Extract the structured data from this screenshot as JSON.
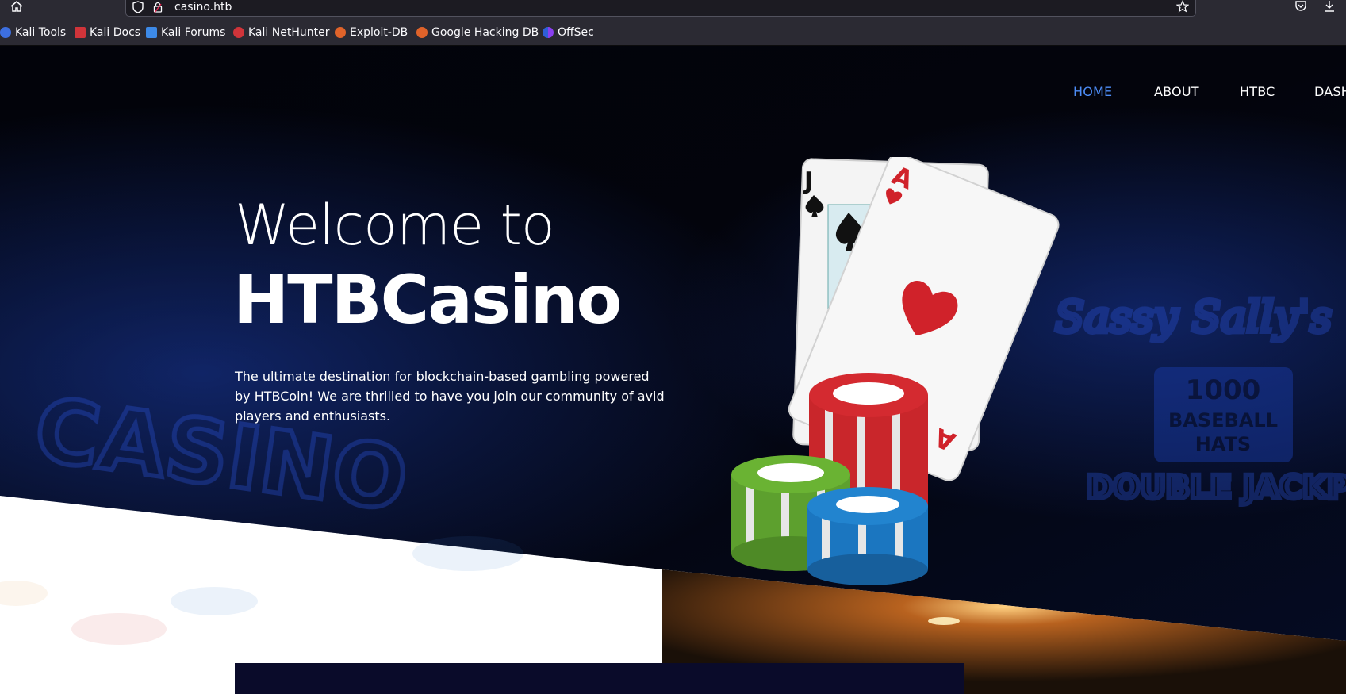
{
  "browser": {
    "url": "casino.htb",
    "bookmarks": [
      "Kali Tools",
      "Kali Docs",
      "Kali Forums",
      "Kali NetHunter",
      "Exploit-DB",
      "Google Hacking DB",
      "OffSec"
    ]
  },
  "nav": {
    "items": [
      "HOME",
      "ABOUT",
      "HTBC",
      "DASH"
    ],
    "active": "HOME"
  },
  "hero": {
    "title_line1": "Welcome to",
    "title_line2": "HTBCasino",
    "description": "The ultimate destination for blockchain-based gambling powered by HTBCoin! We are thrilled to have you join our community of avid players and enthusiasts."
  },
  "colors": {
    "nav_active": "#4d8df7",
    "hero_bg": "#03040c",
    "neon_blue": "#1b3fb0",
    "dark_box": "#0a0b2a"
  },
  "icons": {
    "home": "home-icon",
    "shield": "shield-icon",
    "lock": "lock-icon",
    "star": "star-icon",
    "pocket": "pocket-icon",
    "download": "download-icon"
  }
}
